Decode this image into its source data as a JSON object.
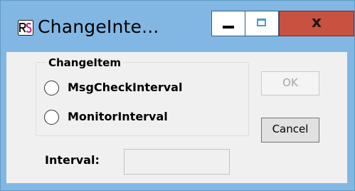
{
  "window": {
    "title": "ChangeInte...",
    "icon": "app-logo-icon",
    "controls": {
      "minimize": "minimize-icon",
      "maximize": "maximize-icon",
      "close_label": "x"
    }
  },
  "group": {
    "label": "ChangeItem",
    "options": [
      {
        "label": "MsgCheckInterval",
        "selected": false
      },
      {
        "label": "MonitorInterval",
        "selected": false
      }
    ]
  },
  "buttons": {
    "ok_label": "OK",
    "ok_enabled": false,
    "cancel_label": "Cancel"
  },
  "interval": {
    "label": "Interval:",
    "value": "",
    "enabled": false
  },
  "colors": {
    "title_bar": "#82b7e3",
    "close_button": "#c9513f",
    "client_background": "#f0f0f0"
  }
}
